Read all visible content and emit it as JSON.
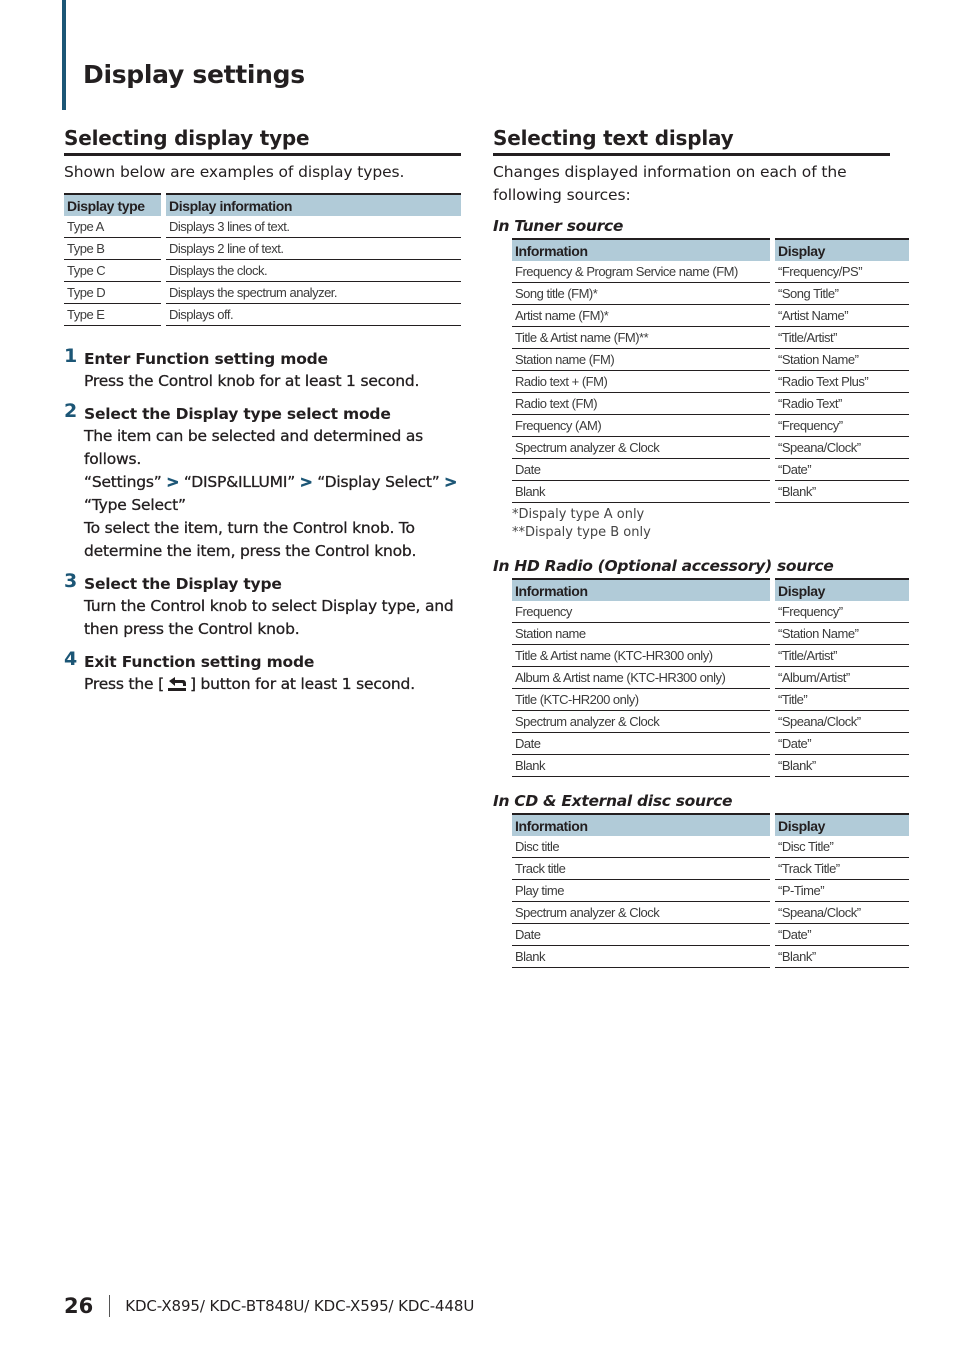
{
  "page": {
    "title": "Display settings",
    "accent_color": "#1c5676",
    "table_header_color": "#b1cbd8"
  },
  "left": {
    "section_title": "Selecting display type",
    "intro": "Shown below are examples of display types.",
    "types_table": {
      "headers": [
        "Display type",
        "Display information"
      ],
      "rows": [
        [
          "Type A",
          "Displays 3 lines of text."
        ],
        [
          "Type B",
          "Displays 2 line of text."
        ],
        [
          "Type C",
          "Displays the clock."
        ],
        [
          "Type D",
          "Displays the spectrum analyzer."
        ],
        [
          "Type E",
          "Displays off."
        ]
      ]
    },
    "steps": [
      {
        "num": "1",
        "title": "Enter Function setting mode",
        "body": [
          "Press the Control knob for at least 1 second."
        ]
      },
      {
        "num": "2",
        "title": "Select the Display type select mode",
        "body_intro": "The item can be selected and determined as follows.",
        "path": [
          "“Settings”",
          "“DISP&ILLUMI”",
          "“Display Select”",
          "“Type Select”"
        ],
        "path_separator": ">",
        "body_outro": "To select the item, turn the Control knob. To determine the item, press the Control knob."
      },
      {
        "num": "3",
        "title": "Select the Display type",
        "body": [
          "Turn the Control knob to select Display type, and then press the Control knob."
        ]
      },
      {
        "num": "4",
        "title": "Exit Function setting mode",
        "body_before_icon": "Press the [",
        "icon": "return-icon",
        "body_after_icon": "] button for at least 1 second."
      }
    ]
  },
  "right": {
    "section_title": "Selecting text display",
    "intro": "Changes displayed information on each of the following sources:",
    "sources": [
      {
        "title": "In Tuner source",
        "headers": [
          "Information",
          "Display"
        ],
        "rows": [
          [
            "Frequency & Program Service name (FM)",
            "“Frequency/PS”"
          ],
          [
            "Song title (FM)*",
            "“Song Title”"
          ],
          [
            "Artist name (FM)*",
            "“Artist Name”"
          ],
          [
            "Title & Artist name (FM)**",
            "“Title/Artist”"
          ],
          [
            "Station name (FM)",
            "“Station Name”"
          ],
          [
            "Radio text + (FM)",
            "“Radio Text Plus”"
          ],
          [
            "Radio text (FM)",
            "“Radio Text”"
          ],
          [
            "Frequency (AM)",
            "“Frequency”"
          ],
          [
            "Spectrum analyzer & Clock",
            "“Speana/Clock”"
          ],
          [
            "Date",
            "“Date”"
          ],
          [
            "Blank",
            "“Blank”"
          ]
        ],
        "notes": [
          "*Dispaly type A only",
          "**Dispaly type B only"
        ]
      },
      {
        "title": "In HD Radio (Optional accessory) source",
        "headers": [
          "Information",
          "Display"
        ],
        "rows": [
          [
            "Frequency",
            "“Frequency”"
          ],
          [
            "Station name",
            "“Station Name”"
          ],
          [
            "Title & Artist name (KTC-HR300 only)",
            "“Title/Artist”"
          ],
          [
            "Album & Artist name (KTC-HR300 only)",
            "“Album/Artist”"
          ],
          [
            "Title  (KTC-HR200 only)",
            "“Title”"
          ],
          [
            "Spectrum analyzer & Clock",
            "“Speana/Clock”"
          ],
          [
            "Date",
            "“Date”"
          ],
          [
            "Blank",
            "“Blank”"
          ]
        ],
        "notes": []
      },
      {
        "title": "In CD & External disc source",
        "headers": [
          "Information",
          "Display"
        ],
        "rows": [
          [
            "Disc title",
            "“Disc Title”"
          ],
          [
            "Track title",
            "“Track Title”"
          ],
          [
            "Play time",
            "“P-Time”"
          ],
          [
            "Spectrum analyzer & Clock",
            "“Speana/Clock”"
          ],
          [
            "Date",
            "“Date”"
          ],
          [
            "Blank",
            "“Blank”"
          ]
        ],
        "notes": []
      }
    ]
  },
  "footer": {
    "page_number": "26",
    "models": "KDC-X895/ KDC-BT848U/ KDC-X595/ KDC-448U"
  }
}
